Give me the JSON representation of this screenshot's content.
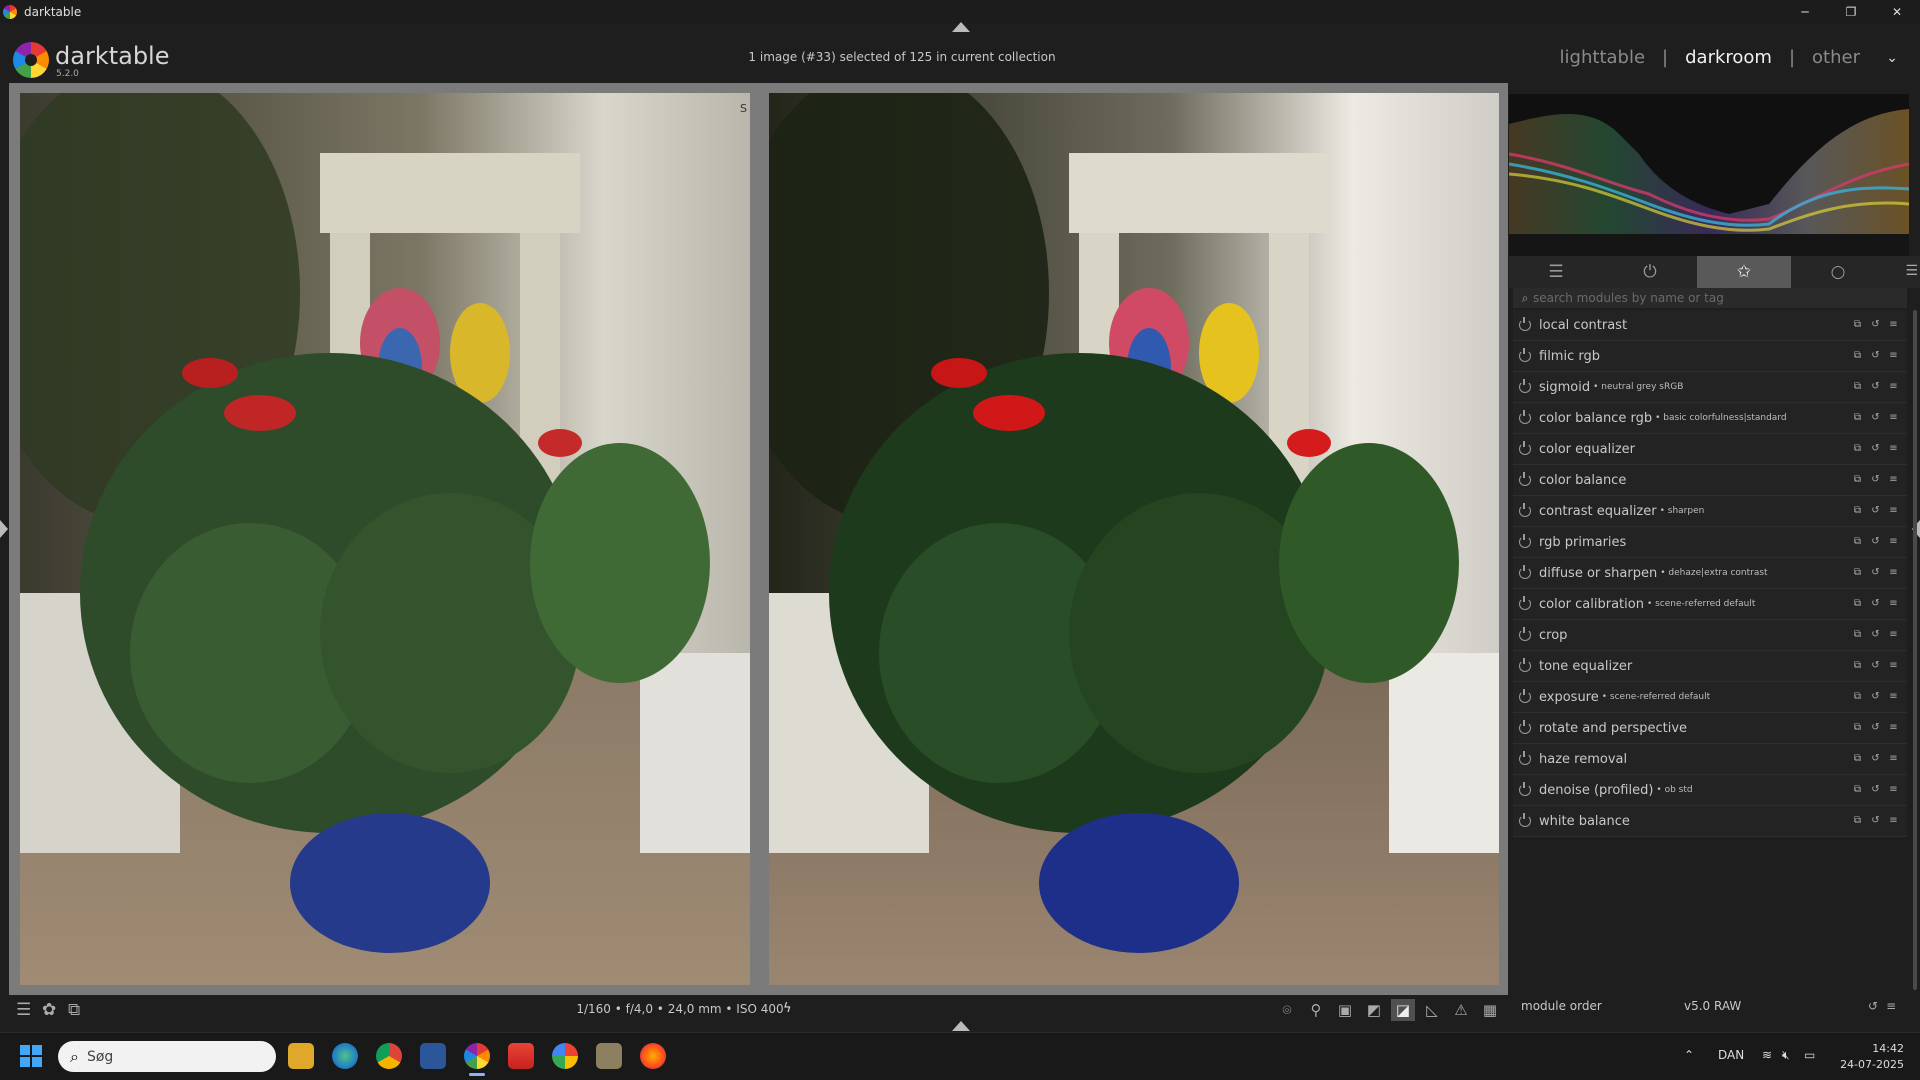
{
  "window": {
    "title": "darktable",
    "buttons": [
      "─",
      "❐",
      "✕"
    ]
  },
  "header": {
    "app_name": "darktable",
    "version": "5.2.0",
    "collection_info": "1 image (#33) selected of 125 in current collection",
    "views": [
      {
        "label": "lighttable",
        "active": false
      },
      {
        "label": "darkroom",
        "active": true
      },
      {
        "label": "other",
        "active": false
      }
    ],
    "view_separator": "|"
  },
  "viewport": {
    "split_marker": "S"
  },
  "right_panel": {
    "tabs": [
      {
        "icon": "sliders-icon",
        "glyph": "☰",
        "active": false
      },
      {
        "icon": "power-icon",
        "glyph": "⏻",
        "active": false
      },
      {
        "icon": "star-icon",
        "glyph": "✩",
        "active": true
      },
      {
        "icon": "circle-icon",
        "glyph": "○",
        "active": false
      }
    ],
    "search_placeholder": "search modules by name or tag",
    "modules": [
      {
        "name": "local contrast",
        "label": ""
      },
      {
        "name": "filmic rgb",
        "label": ""
      },
      {
        "name": "sigmoid",
        "label": "• neutral grey sRGB"
      },
      {
        "name": "color balance rgb",
        "label": "• basic colorfulness|standard"
      },
      {
        "name": "color equalizer",
        "label": ""
      },
      {
        "name": "color balance",
        "label": ""
      },
      {
        "name": "contrast equalizer",
        "label": "• sharpen"
      },
      {
        "name": "rgb primaries",
        "label": ""
      },
      {
        "name": "diffuse or sharpen",
        "label": "• dehaze|extra contrast"
      },
      {
        "name": "color calibration",
        "label": "• scene-referred default"
      },
      {
        "name": "crop",
        "label": ""
      },
      {
        "name": "tone equalizer",
        "label": ""
      },
      {
        "name": "exposure",
        "label": "• scene-referred default"
      },
      {
        "name": "rotate and perspective",
        "label": ""
      },
      {
        "name": "haze removal",
        "label": ""
      },
      {
        "name": "denoise (profiled)",
        "label": "• ob std"
      },
      {
        "name": "white balance",
        "label": ""
      }
    ],
    "module_order_label": "module order",
    "module_order_value": "v5.0 RAW"
  },
  "bottom": {
    "exif": "1/160 • f/4,0 • 24,0 mm • ISO 400",
    "flash_glyph": "ϟ"
  },
  "taskbar": {
    "search_placeholder": "Søg",
    "language": "DAN",
    "time": "14:42",
    "date": "24-07-2025"
  }
}
